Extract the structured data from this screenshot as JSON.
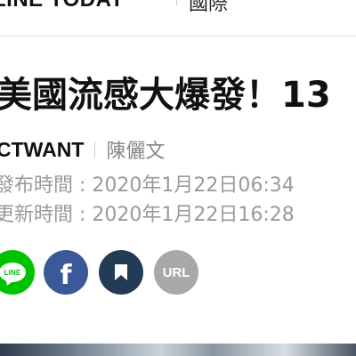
{
  "header": {
    "logo": "LINE TODAY",
    "section": "國際"
  },
  "article": {
    "title": "美國流感大爆發！13",
    "source": "CTWANT",
    "author": "陳儷文",
    "published": "發布時間 : 2020年1月22日06:34",
    "updated": "更新時間 : 2020年1月22日16:28"
  },
  "share": {
    "line_label": "LINE",
    "facebook_glyph": "f",
    "url_label": "URL",
    "icons": [
      "line-icon",
      "facebook-icon",
      "bookmark-icon",
      "link-icon"
    ],
    "colors": {
      "line": "#00c300",
      "facebook": "#3b5998",
      "bookmark": "#243b56",
      "url": "#a8a8a8"
    }
  }
}
